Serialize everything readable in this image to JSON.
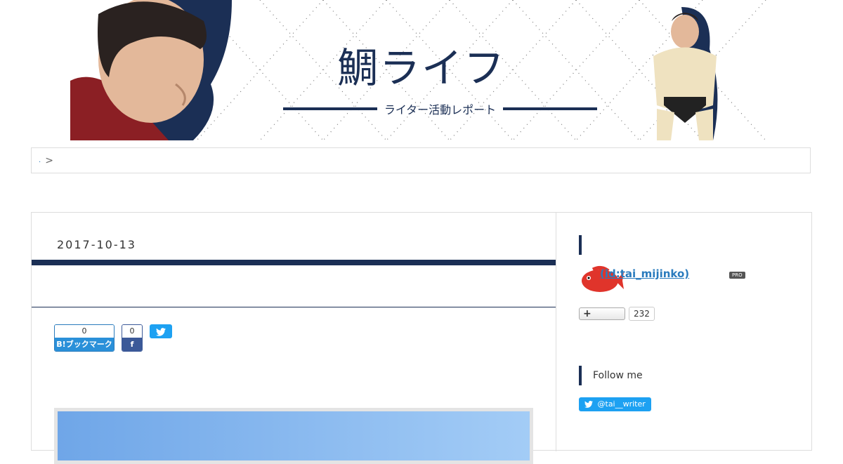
{
  "header": {
    "title": "鯛ライフ",
    "subtitle": "ライター活動レポート",
    "colors": {
      "navy": "#1b2f55",
      "skin": "#e3b89a",
      "shirt": "#8b1f24"
    }
  },
  "breadcrumb": {
    "home_link": ".",
    "separator": ">"
  },
  "post": {
    "date": "2017-10-13",
    "title": "",
    "lead": "",
    "share": {
      "hatena_count": "0",
      "hatena_label": "B!ブックマーク",
      "facebook_count": "0",
      "facebook_label": "f",
      "twitter_icon": "twitter-icon"
    }
  },
  "sidebar": {
    "profile": {
      "heading": "",
      "name": "(id:tai_mijinko)",
      "badge": "PRO",
      "follow_label": "+",
      "follow_count": "232",
      "avatar_icon": "red-fish-icon"
    },
    "follow_me": {
      "heading": "Follow me",
      "twitter_label": "@tai__writer"
    }
  }
}
